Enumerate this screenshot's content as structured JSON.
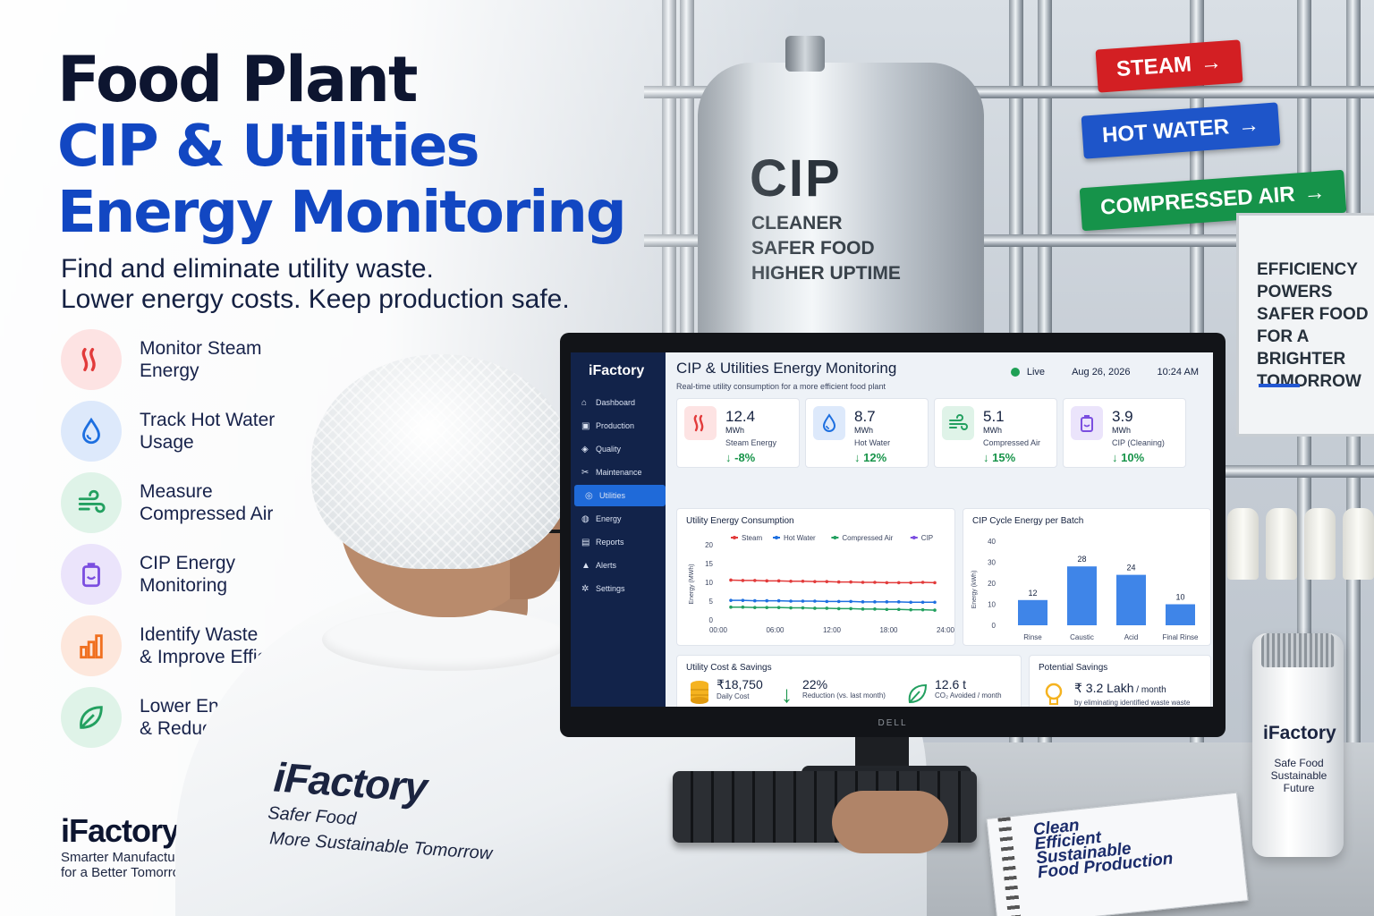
{
  "headline": {
    "line1": "Food Plant",
    "line2": "CIP & Utilities",
    "line3": "Energy Monitoring",
    "sub1": "Find and eliminate utility waste.",
    "sub2": "Lower energy costs. Keep production safe."
  },
  "features": [
    {
      "l1": "Monitor Steam",
      "l2": "Energy",
      "icon": "steam-icon",
      "bg": "#fde3e3",
      "color": "#e23b3b"
    },
    {
      "l1": "Track Hot Water",
      "l2": "Usage",
      "icon": "water-drop-icon",
      "bg": "#dde9fb",
      "color": "#1d6fe0"
    },
    {
      "l1": "Measure",
      "l2": "Compressed Air",
      "icon": "wind-icon",
      "bg": "#dff3e8",
      "color": "#23a060"
    },
    {
      "l1": "CIP Energy",
      "l2": "Monitoring",
      "icon": "cip-tank-icon",
      "bg": "#ebe4fb",
      "color": "#7b4ee0"
    },
    {
      "l1": "Identify Waste",
      "l2": "& Improve Efficiency",
      "icon": "bar-chart-icon",
      "bg": "#fde7dc",
      "color": "#f07020"
    },
    {
      "l1": "Lower Energy Costs",
      "l2": "& Reduce Emissions",
      "icon": "leaf-icon",
      "bg": "#dff3e8",
      "color": "#23a060"
    }
  ],
  "brand": {
    "name": "iFactory",
    "tag1": "Smarter Manufacturing",
    "tag2": "for a Better Tomorrow"
  },
  "scene": {
    "tank_title": "CIP",
    "tank_l1": "CLEANER",
    "tank_l2": "SAFER FOOD",
    "tank_l3": "HIGHER UPTIME",
    "tag_steam": "STEAM",
    "tag_hot": "HOT WATER",
    "tag_air": "COMPRESSED AIR",
    "board": [
      "EFFICIENCY",
      "POWERS",
      "SAFER FOOD",
      "FOR A BRIGHTER",
      "TOMORROW"
    ],
    "coat_name": "iFactory",
    "coat_l1": "Safer Food",
    "coat_l2": "More Sustainable Tomorrow",
    "notebook": [
      "Clean",
      "Efficient",
      "Sustainable",
      "Food Production"
    ],
    "bottle_name": "iFactory",
    "bottle_l1": "Safe Food",
    "bottle_l2": "Sustainable Future",
    "monitor_brand": "DELL"
  },
  "dashboard": {
    "logo": "iFactory",
    "nav": [
      {
        "label": "Dashboard",
        "icon": "home-icon",
        "active": false
      },
      {
        "label": "Production",
        "icon": "factory-icon",
        "active": false
      },
      {
        "label": "Quality",
        "icon": "shield-icon",
        "active": false
      },
      {
        "label": "Maintenance",
        "icon": "wrench-icon",
        "active": false
      },
      {
        "label": "Utilities",
        "icon": "utilities-icon",
        "active": true
      },
      {
        "label": "Energy",
        "icon": "energy-icon",
        "active": false
      },
      {
        "label": "Reports",
        "icon": "report-icon",
        "active": false
      },
      {
        "label": "Alerts",
        "icon": "alert-icon",
        "active": false
      },
      {
        "label": "Settings",
        "icon": "gear-icon",
        "active": false
      }
    ],
    "title": "CIP & Utilities Energy Monitoring",
    "subtitle": "Real-time utility consumption for a more efficient food plant",
    "status": "Live",
    "date": "Aug 26, 2026",
    "time": "10:24 AM",
    "kpis": [
      {
        "value": "12.4",
        "unit": "MWh",
        "label": "Steam Energy",
        "change": "↓ -8%",
        "icon": "steam-icon",
        "bg": "#fde3e3",
        "color": "#e23b3b"
      },
      {
        "value": "8.7",
        "unit": "MWh",
        "label": "Hot Water",
        "change": "↓ 12%",
        "icon": "water-drop-icon",
        "bg": "#dde9fb",
        "color": "#1d6fe0"
      },
      {
        "value": "5.1",
        "unit": "MWh",
        "label": "Compressed Air",
        "change": "↓ 15%",
        "icon": "wind-icon",
        "bg": "#dff3e8",
        "color": "#23a060"
      },
      {
        "value": "3.9",
        "unit": "MWh",
        "label": "CIP (Cleaning)",
        "change": "↓ 10%",
        "icon": "cip-tank-icon",
        "bg": "#ebe4fb",
        "color": "#7b4ee0"
      }
    ],
    "cost": {
      "title": "Utility Cost & Savings",
      "daily_value": "₹18,750",
      "daily_label": "Daily Cost",
      "reduction_value": "22%",
      "reduction_label": "Reduction (vs. last month)",
      "co2_value": "12.6 t",
      "co2_label": "CO₂ Avoided / month"
    },
    "savings": {
      "title": "Potential Savings",
      "value": "₹ 3.2 Lakh",
      "unit": " / month",
      "desc": "by eliminating identified waste waste"
    }
  },
  "chart_data": [
    {
      "type": "line",
      "title": "Utility Energy Consumption",
      "ylabel": "Energy (MWh)",
      "xlabel": "",
      "x": [
        "00:00",
        "06:00",
        "12:00",
        "18:00",
        "24:00"
      ],
      "ylim": [
        0,
        20
      ],
      "yticks": [
        0,
        5,
        10,
        15,
        20
      ],
      "series": [
        {
          "name": "Steam",
          "color": "#e23b3b",
          "values": [
            10.6,
            10.5,
            10.5,
            10.4,
            10.4,
            10.3,
            10.3,
            10.2,
            10.2,
            10.1,
            10.1,
            10.0,
            10.0,
            9.9,
            9.9,
            9.9,
            10.0,
            9.9
          ]
        },
        {
          "name": "Hot Water",
          "color": "#1d6fe0",
          "values": [
            5.2,
            5.2,
            5.1,
            5.1,
            5.1,
            5.0,
            5.0,
            5.0,
            4.9,
            4.9,
            4.9,
            4.8,
            4.8,
            4.8,
            4.8,
            4.7,
            4.7,
            4.7
          ]
        },
        {
          "name": "Compressed Air",
          "color": "#23a060",
          "values": [
            3.4,
            3.4,
            3.3,
            3.3,
            3.3,
            3.2,
            3.2,
            3.1,
            3.1,
            3.0,
            3.0,
            2.9,
            2.9,
            2.8,
            2.8,
            2.7,
            2.7,
            2.6
          ]
        },
        {
          "name": "CIP",
          "color": "#7b4ee0",
          "values": []
        }
      ],
      "legend": "top",
      "grid": false
    },
    {
      "type": "bar",
      "title": "CIP Cycle Energy per Batch",
      "ylabel": "Energy (kWh)",
      "categories": [
        "Rinse",
        "Caustic",
        "Acid",
        "Final Rinse"
      ],
      "values": [
        12,
        28,
        24,
        10
      ],
      "ylim": [
        0,
        40
      ],
      "yticks": [
        0,
        10,
        20,
        30,
        40
      ],
      "color": "#3f85e8",
      "grid": false
    }
  ]
}
